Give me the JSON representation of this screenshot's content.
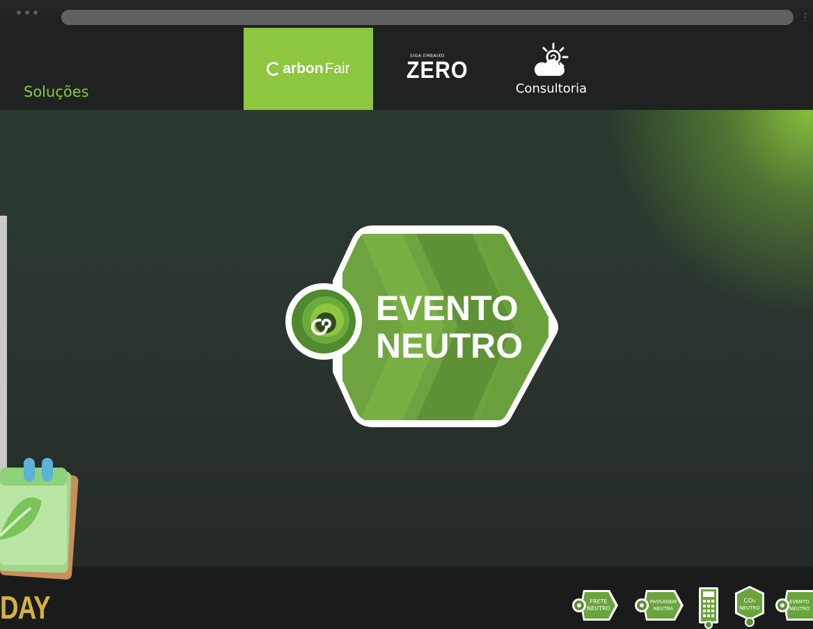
{
  "nav": {
    "solucoes_label": "Soluções",
    "tabs": [
      {
        "brand_bold": "arbon",
        "brand_light": "Fair"
      },
      {
        "small": "SIGA EMBAIXO",
        "big": "ZERO"
      },
      {
        "label": "Consultoria"
      }
    ]
  },
  "hero": {
    "logo_line1": "EVENTO",
    "logo_line2": "NEUTRO"
  },
  "footer": {
    "day_text": "DAY",
    "badges": [
      {
        "line1": "FRETE",
        "line2": "NEUTRO"
      },
      {
        "line1": "PASSAGEM",
        "line2": "NEUTRA"
      },
      {
        "line1": "",
        "line2": ""
      },
      {
        "line1": "CO₂",
        "line2": "NEUTRO"
      },
      {
        "line1": "EVENTO",
        "line2": "NEUTRO"
      }
    ]
  },
  "colors": {
    "accent": "#8dc63f",
    "dark": "#1f2221"
  },
  "icons": [
    "cloud-sun-icon",
    "calculator-icon",
    "leaf-calendar-icon",
    "spiral-logo-icon"
  ]
}
